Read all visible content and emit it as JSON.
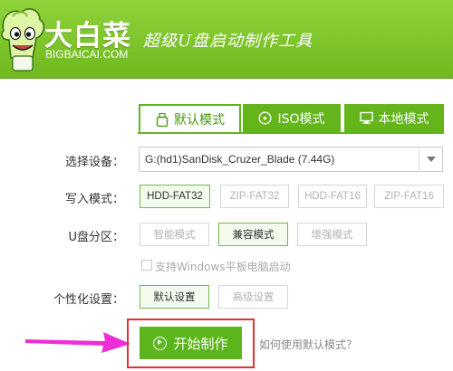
{
  "header": {
    "logo_cn": "大白菜",
    "logo_en": "BIGBAICAI.COM",
    "slogan": "超级U盘启动制作工具"
  },
  "tabs": [
    {
      "label": "默认模式",
      "icon": "usb-drive-icon",
      "active": true
    },
    {
      "label": "ISO模式",
      "icon": "disc-icon",
      "active": false
    },
    {
      "label": "本地模式",
      "icon": "monitor-icon",
      "active": false
    }
  ],
  "form": {
    "device_label": "选择设备：",
    "device_value": "G:(hd1)SanDisk_Cruzer_Blade (7.44G)",
    "write_mode_label": "写入模式：",
    "write_modes": [
      "HDD-FAT32",
      "ZIP-FAT32",
      "HDD-FAT16",
      "ZIP-FAT16"
    ],
    "write_mode_selected": "HDD-FAT32",
    "partition_label": "U盘分区：",
    "partitions": [
      "智能模式",
      "兼容模式",
      "增强模式"
    ],
    "partition_selected": "兼容模式",
    "windows_tablet_checkbox": "支持Windows平板电脑启动",
    "windows_tablet_checked": false,
    "personalize_label": "个性化设置：",
    "personalize_options": [
      "默认设置",
      "高级设置"
    ],
    "personalize_selected": "默认设置"
  },
  "actions": {
    "start_button": "开始制作",
    "help_link": "如何使用默认模式？"
  },
  "colors": {
    "brand_green": "#63b51b",
    "highlight_red": "#e0303a",
    "arrow_magenta": "#ee2fd6"
  }
}
